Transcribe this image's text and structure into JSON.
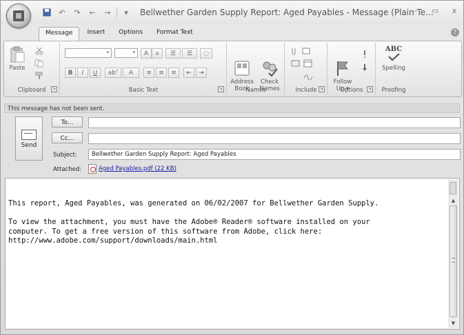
{
  "window": {
    "title": "Bellwether Garden Supply Report: Aged Payables - Message (Plain Te...",
    "controls": {
      "minimize": "–",
      "maximize": "▭",
      "close": "x"
    }
  },
  "qat": {
    "save": "💾",
    "undo": "↶",
    "redo": "↷",
    "prev": "←",
    "next": "→",
    "more": "▾"
  },
  "ribbon": {
    "tabs": [
      "Message",
      "Insert",
      "Options",
      "Format Text"
    ],
    "help": "?",
    "groups": {
      "clipboard": {
        "label": "Clipboard",
        "paste": "Paste"
      },
      "basic_text": {
        "label": "Basic Text"
      },
      "names": {
        "label": "Names",
        "address_book": "Address\nBook",
        "check_names": "Check\nNames"
      },
      "include": {
        "label": "Include"
      },
      "options": {
        "label": "Options",
        "follow_up": "Follow\nUp ▾"
      },
      "proofing": {
        "label": "Proofing",
        "spelling": "Spelling",
        "abc": "ABC"
      }
    },
    "format_buttons": {
      "bold": "B",
      "italic": "I",
      "underline": "U",
      "grow": "A",
      "shrink": "A",
      "align": "≡",
      "bullets": "☰",
      "numbering": "☰"
    }
  },
  "compose": {
    "status": "This message has not been sent.",
    "send": "Send",
    "to_button": "To...",
    "cc_button": "Cc...",
    "to_value": "",
    "cc_value": "",
    "subject_label": "Subject:",
    "subject_value": "Bellwether Garden Supply Report: Aged Payables",
    "attached_label": "Attached:",
    "attachment": "Aged Payables.pdf (22 KB)"
  },
  "body": {
    "text": "This report, Aged Payables, was generated on 06/02/2007 for Bellwether Garden Supply.\n\nTo view the attachment, you must have the Adobe® Reader® software installed on your\ncomputer. To get a free version of this software from Adobe, click here:\nhttp://www.adobe.com/support/downloads/main.html"
  },
  "colors": {
    "link": "#1a1aa6",
    "chrome": "#e4e4e4",
    "status_bar": "#d9d9d9"
  }
}
